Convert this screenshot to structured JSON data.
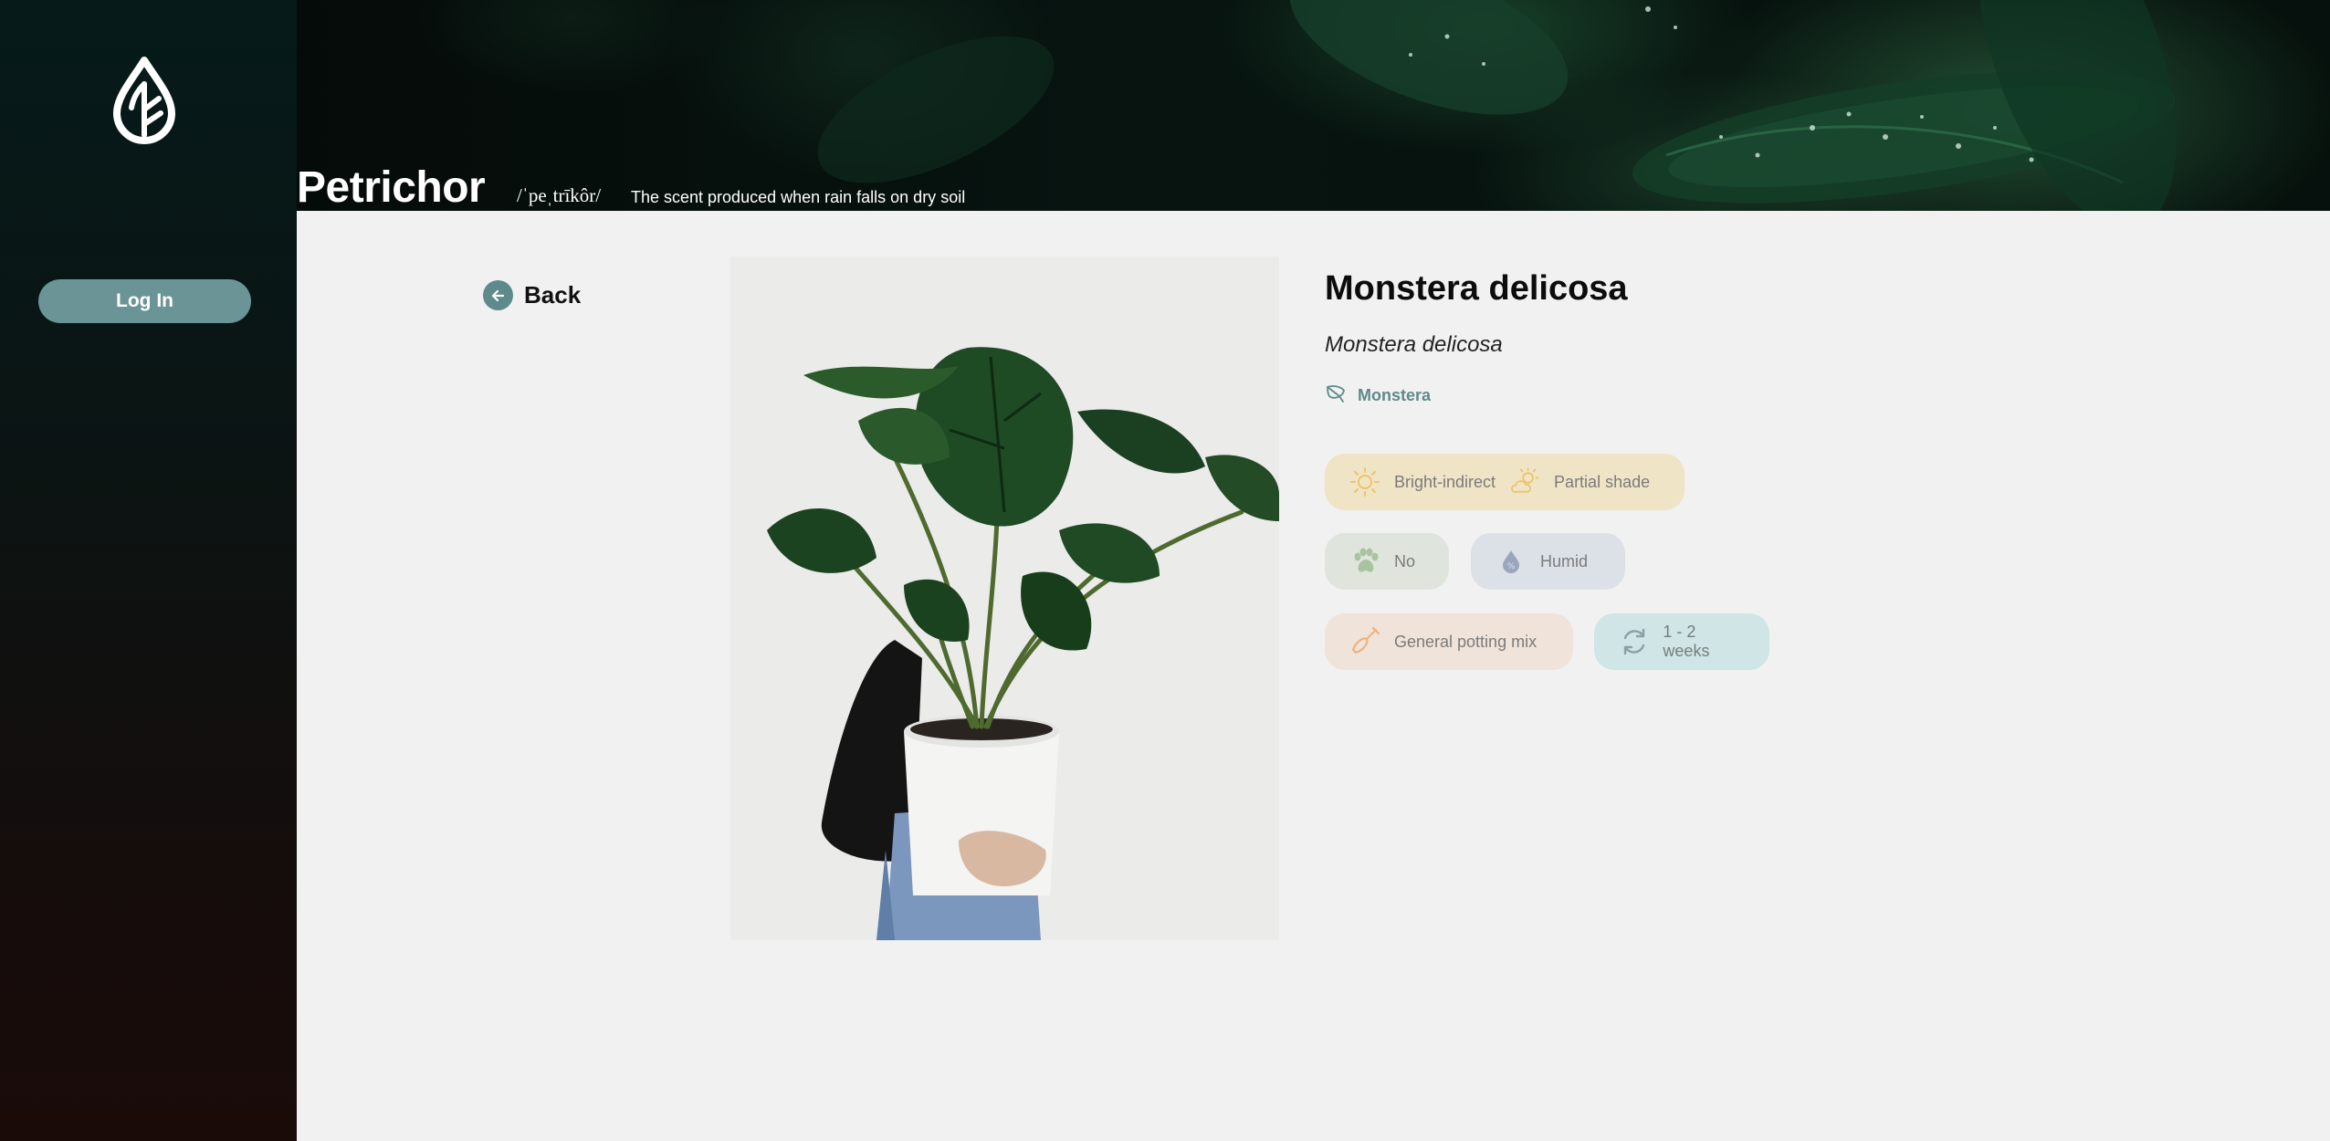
{
  "sidebar": {
    "logo_icon": "leaf-drop-icon",
    "login_label": "Log In"
  },
  "header": {
    "brand": "Petrichor",
    "phonetic": "/ˈpeˌtrīkôr/",
    "definition": "The scent produced when rain falls on dry soil"
  },
  "nav": {
    "back_label": "Back",
    "back_icon": "arrow-left-icon"
  },
  "plant": {
    "common_name": "Monstera delicosa",
    "scientific_name": "Monstera delicosa",
    "genus": "Monstera",
    "genus_icon": "leaf-icon",
    "light": {
      "primary": "Bright-indirect",
      "secondary": "Partial shade",
      "primary_icon": "sun-icon",
      "secondary_icon": "partly-cloudy-icon"
    },
    "pet_safe": "No",
    "pet_icon": "paw-icon",
    "humidity": "Humid",
    "humidity_icon": "water-drop-icon",
    "soil": "General potting mix",
    "soil_icon": "shovel-icon",
    "watering": "1 - 2 weeks",
    "watering_icon": "refresh-icon"
  },
  "colors": {
    "accent": "#6a9495",
    "light_pill": "#efe4c6",
    "pet_pill": "#dfe5dc",
    "humidity_pill": "#dce1e8",
    "soil_pill": "#f0e3da",
    "water_pill": "#cfe5e6"
  }
}
